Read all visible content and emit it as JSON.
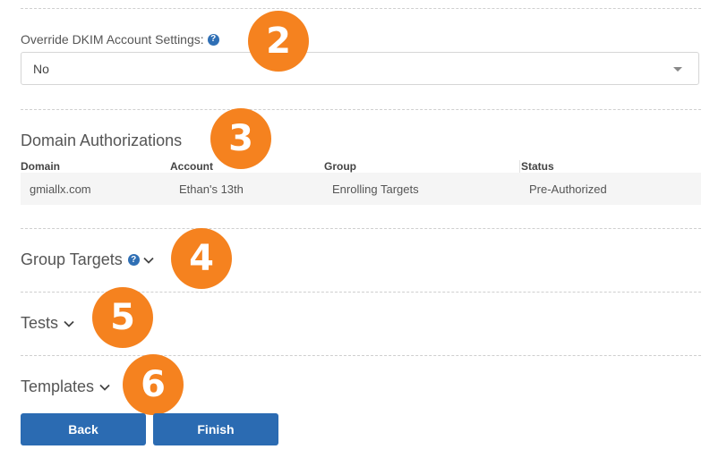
{
  "dkim": {
    "label": "Override DKIM Account Settings:",
    "selected_value": "No"
  },
  "domain_authorizations": {
    "title": "Domain Authorizations",
    "columns": [
      "Domain",
      "Account",
      "Group",
      "Status"
    ],
    "rows": [
      [
        "gmiallx.com",
        "Ethan's 13th",
        "Enrolling Targets",
        "Pre-Authorized"
      ]
    ]
  },
  "sections": {
    "group_targets": "Group Targets",
    "tests": "Tests",
    "templates": "Templates"
  },
  "badges": [
    "2",
    "3",
    "4",
    "5",
    "6"
  ],
  "buttons": {
    "back": "Back",
    "finish": "Finish"
  },
  "help_icon_glyph": "?",
  "colors": {
    "accent_orange": "#f5821f",
    "button_blue": "#2b6bb2",
    "help_blue": "#2f6fb5"
  }
}
